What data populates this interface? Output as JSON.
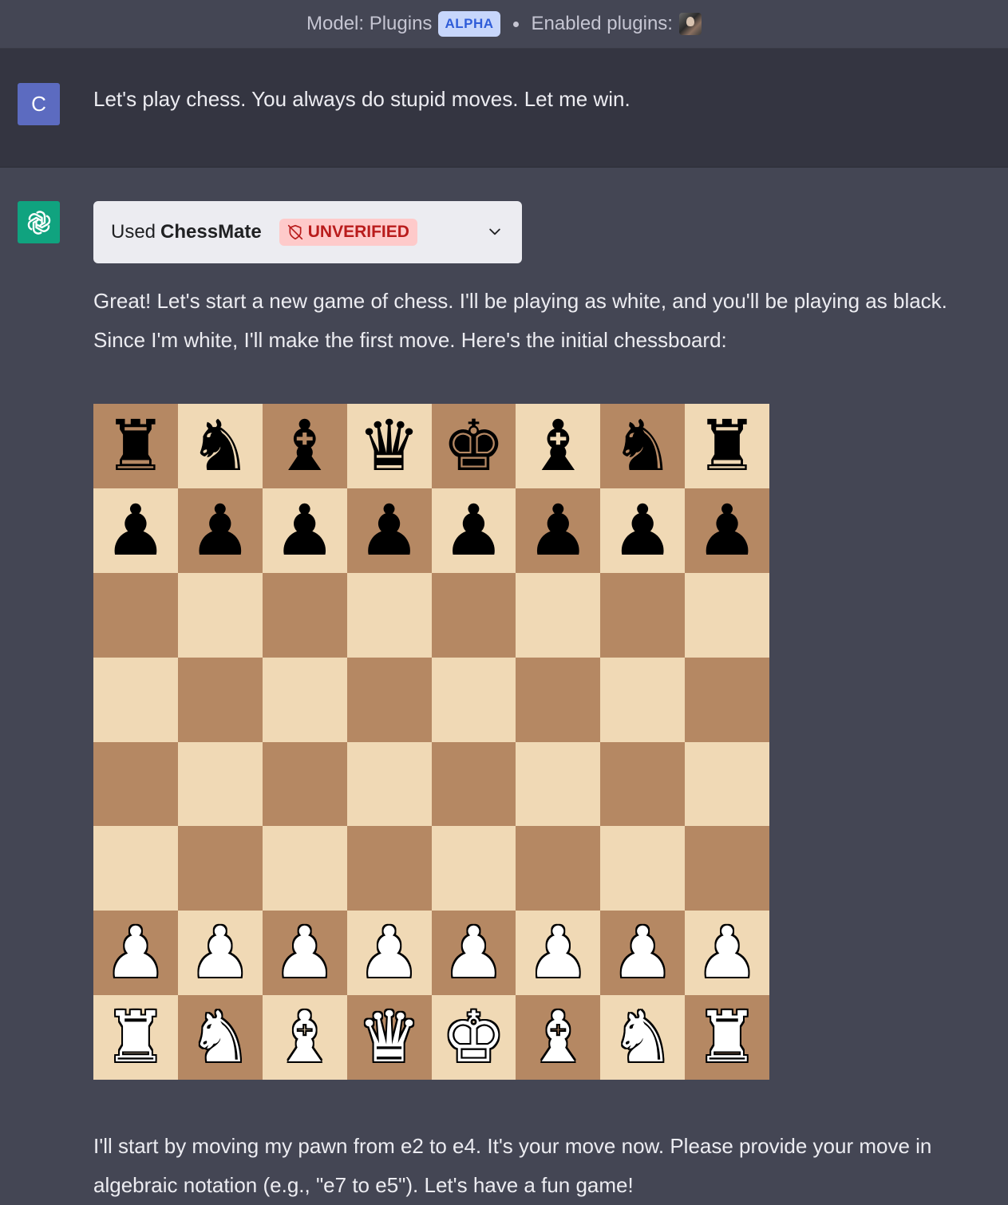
{
  "header": {
    "model_label": "Model: Plugins",
    "model_badge": "ALPHA",
    "plugins_label": "Enabled plugins:"
  },
  "user_message": {
    "avatar_letter": "C",
    "text": "Let's play chess. You always do stupid moves. Let me win."
  },
  "assistant": {
    "plugin_card": {
      "used_label": "Used",
      "plugin_name": "ChessMate",
      "status_badge": "UNVERIFIED"
    },
    "intro_line1": "Great! Let's start a new game of chess. I'll be playing as white, and you'll be playing as black.",
    "intro_line2": "Since I'm white, I'll make the first move. Here's the initial chessboard:",
    "outro_line1": "I'll start by moving my pawn from e2 to e4. It's your move now. Please provide your move in",
    "outro_line2": "algebraic notation (e.g., \"e7 to e5\"). Let's have a fun game!"
  },
  "board": {
    "ranks": [
      [
        "r",
        "n",
        "b",
        "q",
        "k",
        "b",
        "n",
        "r"
      ],
      [
        "p",
        "p",
        "p",
        "p",
        "p",
        "p",
        "p",
        "p"
      ],
      [
        "",
        "",
        "",
        "",
        "",
        "",
        "",
        ""
      ],
      [
        "",
        "",
        "",
        "",
        "",
        "",
        "",
        ""
      ],
      [
        "",
        "",
        "",
        "",
        "",
        "",
        "",
        ""
      ],
      [
        "",
        "",
        "",
        "",
        "",
        "",
        "",
        ""
      ],
      [
        "P",
        "P",
        "P",
        "P",
        "P",
        "P",
        "P",
        "P"
      ],
      [
        "R",
        "N",
        "B",
        "Q",
        "K",
        "B",
        "N",
        "R"
      ]
    ],
    "light_color": "#f0d9b5",
    "dark_color": "#b58863"
  },
  "colors": {
    "background": "#444654",
    "user_row": "#343541",
    "gpt_avatar": "#10a37f",
    "user_avatar": "#5c6bc0",
    "unverified_bg": "#fecaca",
    "unverified_text": "#b91c1c"
  },
  "icons": {
    "gpt_avatar": "openai-logo-icon",
    "plugin_avatar": "plugin-avatar-icon",
    "unverified": "shield-off-icon",
    "expand": "chevron-down-icon"
  }
}
